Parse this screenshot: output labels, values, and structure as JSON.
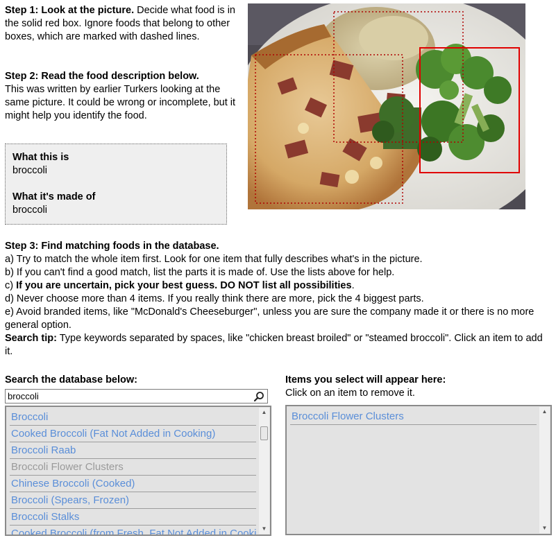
{
  "step1": {
    "heading": "Step 1: Look at the picture.",
    "text": " Decide what food is in the solid red box. Ignore foods that belong to other boxes, which are marked with dashed lines."
  },
  "step2": {
    "heading": "Step 2: Read the food description below.",
    "text": "This was written by earlier Turkers looking at the same picture. It could be wrong or incomplete, but it might help you identify the food."
  },
  "description": {
    "what_label": "What this is",
    "what_value": "broccoli",
    "made_label": "What it's made of",
    "made_value": "broccoli"
  },
  "step3": {
    "heading": "Step 3: Find matching foods in the database.",
    "a": "a) Try to match the whole item first. Look for one item that fully describes what's in the picture.",
    "b": "b) If you can't find a good match, list the parts it is made of. Use the lists above for help.",
    "c_prefix": "c) ",
    "c_bold": "If you are uncertain, pick your best guess. DO NOT list all possibilities",
    "c_suffix": ".",
    "d": "d) Never choose more than 4 items. If you really think there are more, pick the 4 biggest parts.",
    "e": "e) Avoid branded items, like \"McDonald's Cheeseburger\", unless you are sure the company made it or there is no more general option.",
    "tip_label": "Search tip:",
    "tip_text": " Type keywords separated by spaces, like \"chicken breast broiled\" or \"steamed broccoli\". Click an item to add it."
  },
  "search": {
    "title": "Search the database below:",
    "query": "broccoli",
    "results": [
      {
        "label": "Broccoli",
        "disabled": false
      },
      {
        "label": "Cooked Broccoli (Fat Not Added in Cooking)",
        "disabled": false
      },
      {
        "label": "Broccoli Raab",
        "disabled": false
      },
      {
        "label": "Broccoli Flower Clusters",
        "disabled": true
      },
      {
        "label": "Chinese Broccoli (Cooked)",
        "disabled": false
      },
      {
        "label": "Broccoli (Spears, Frozen)",
        "disabled": false
      },
      {
        "label": "Broccoli Stalks",
        "disabled": false
      },
      {
        "label": "Cooked Broccoli (from Fresh, Fat Not Added in Cooking)",
        "disabled": false
      }
    ]
  },
  "selection": {
    "title": "Items you select will appear here:",
    "subtitle": "Click on an item to remove it.",
    "items": [
      "Broccoli Flower Clusters"
    ]
  },
  "colors": {
    "link": "#5a8ed8",
    "disabled": "#9a9a9a",
    "target_box": "#e00000",
    "other_box": "#b00000"
  }
}
